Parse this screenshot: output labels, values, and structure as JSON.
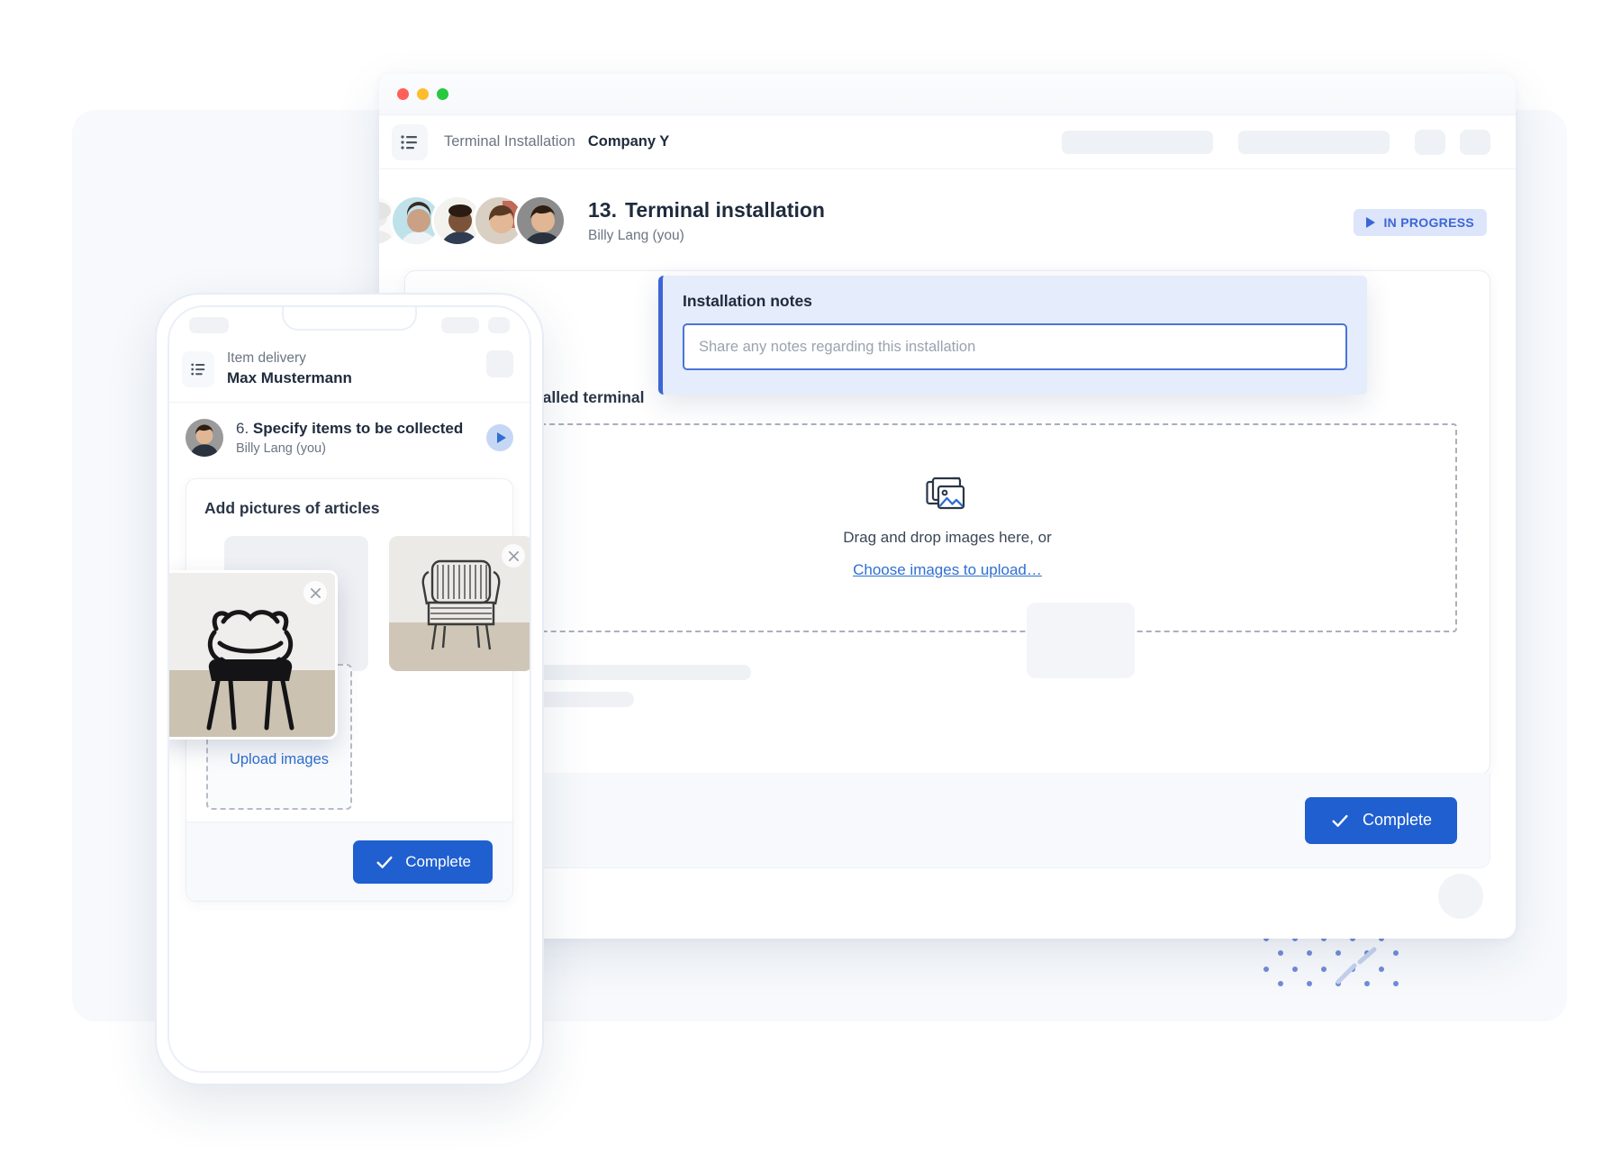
{
  "desktop": {
    "titlebar": {
      "dots": [
        "close-red",
        "minimize-yellow",
        "maximize-green"
      ]
    },
    "toolbar": {
      "list_icon": "list-icon",
      "breadcrumb_muted": "Terminal Installation",
      "breadcrumb_strong": "Company Y",
      "placeholders": 4
    },
    "task": {
      "number": "13.",
      "title": "Terminal installation",
      "assignee": "Billy Lang (you)",
      "status_label": "IN PROGRESS",
      "status_icon": "play-icon",
      "status_bg": "#dde5fa",
      "status_fg": "#3b66d6",
      "avatar_count": 5
    },
    "notes": {
      "label": "Installation notes",
      "input_value": "",
      "input_placeholder": "Share any notes regarding this installation",
      "accent": "#3b66d6"
    },
    "photos": {
      "label": "Photos of installed terminal",
      "dropzone_icon": "images-stack-icon",
      "dropzone_text": "Drag and drop images here, or",
      "dropzone_link": "Choose images to upload…"
    },
    "footer": {
      "complete_label": "Complete",
      "complete_icon": "check-icon",
      "complete_bg": "#1f5fd0"
    }
  },
  "phone": {
    "header": {
      "list_icon": "list-icon",
      "line1": "Item delivery",
      "line2": "Max Mustermann"
    },
    "task": {
      "number": "6.",
      "title": "Specify items to be collected",
      "assignee": "Billy Lang (you)",
      "play_icon": "play-icon"
    },
    "card": {
      "title": "Add pictures of articles",
      "thumbnails": [
        {
          "name": "black-chair-photo",
          "remove_icon": "close-icon"
        },
        {
          "name": "rattan-chair-photo",
          "remove_icon": "close-icon"
        }
      ],
      "upload_icon": "images-stack-icon",
      "upload_label": "Upload images"
    },
    "footer": {
      "complete_label": "Complete",
      "complete_icon": "check-icon"
    }
  },
  "decor": {
    "background_card": "#f7f9fc",
    "dot_color": "#6b86d8",
    "dash_color": "#c3d0ee"
  }
}
